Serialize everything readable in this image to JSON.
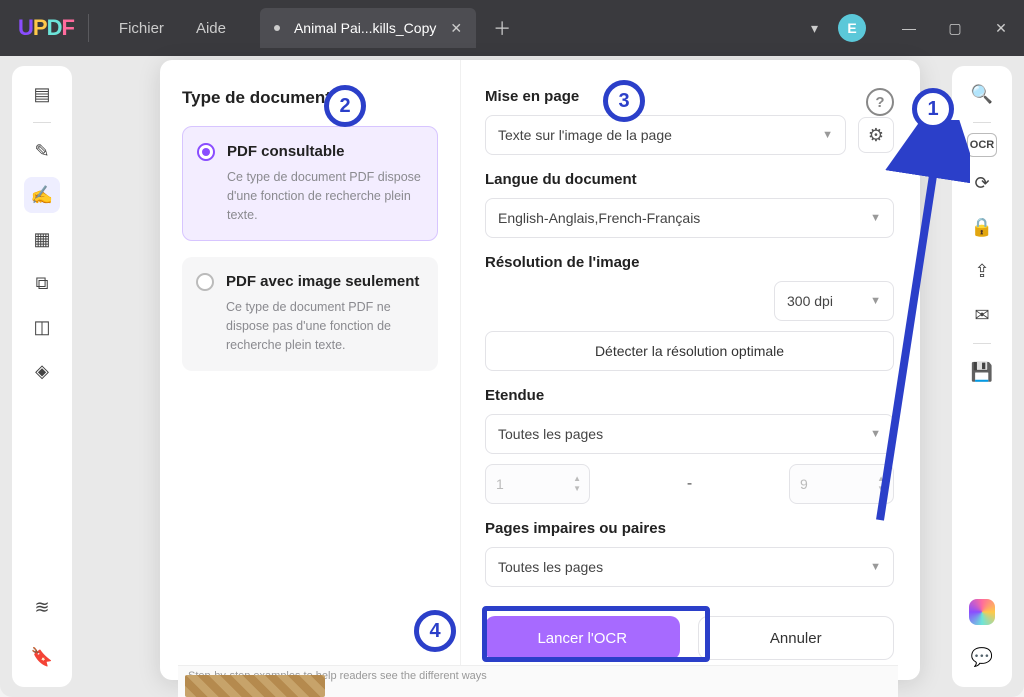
{
  "titlebar": {
    "menus": {
      "file": "Fichier",
      "help": "Aide"
    },
    "tab_title": "Animal Pai...kills_Copy",
    "avatar_letter": "E"
  },
  "left_panel": {
    "heading": "Type de document",
    "option1": {
      "title": "PDF consultable",
      "desc": "Ce type de document PDF dispose d'une fonction de recherche plein texte."
    },
    "option2": {
      "title": "PDF avec image seulement",
      "desc": "Ce type de document PDF ne dispose pas d'une fonction de recherche plein texte."
    }
  },
  "right_panel": {
    "layout_label": "Mise en page",
    "layout_value": "Texte sur l'image de la page",
    "lang_label": "Langue du document",
    "lang_value": "English-Anglais,French-Français",
    "res_label": "Résolution de l'image",
    "res_value": "300 dpi",
    "detect_btn": "Détecter la résolution optimale",
    "range_label": "Etendue",
    "range_value": "Toutes les pages",
    "range_from": "1",
    "range_to": "9",
    "parity_label": "Pages impaires ou paires",
    "parity_value": "Toutes les pages",
    "run_btn": "Lancer l'OCR",
    "cancel_btn": "Annuler"
  },
  "callouts": {
    "c1": "1",
    "c2": "2",
    "c3": "3",
    "c4": "4"
  },
  "doc_peek": "Step-by-step examples to help readers see the different ways"
}
